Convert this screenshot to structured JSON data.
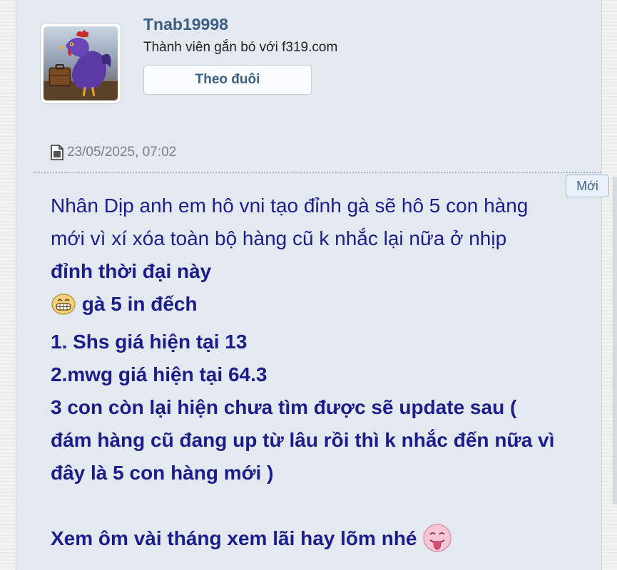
{
  "user": {
    "name": "Tnab19998",
    "title": "Thành viên gắn bó với f319.com",
    "follow_label": "Theo đuôi"
  },
  "post": {
    "date": "23/05/2025, 07:02",
    "new_badge": "Mới",
    "lines": [
      "Nhân Dịp anh em hô vni tạo đỉnh gà sẽ hô 5 con hàng",
      "mới vì xí xóa toàn bộ hàng cũ k nhắc lại nữa ở nhịp",
      "đỉnh thời đại này",
      "gà 5 in đếch",
      "1. Shs giá hiện tại 13",
      "2.mwg giá hiện tại 64.3",
      "3 con còn lại hiện chưa tìm được sẽ update sau (",
      "đám hàng cũ đang up từ lâu rồi thì k nhắc đến nữa vì",
      "đây là 5 con hàng mới )",
      "Xem ôm vài tháng xem lãi hay lõm nhé"
    ]
  },
  "icons": {
    "date": "document-icon",
    "grin": "grin-emoji-icon",
    "tongue": "tongue-emoji-icon"
  },
  "colors": {
    "text": "#1b1e8a",
    "username": "#3c5f84",
    "card": "#e4e8ef"
  }
}
